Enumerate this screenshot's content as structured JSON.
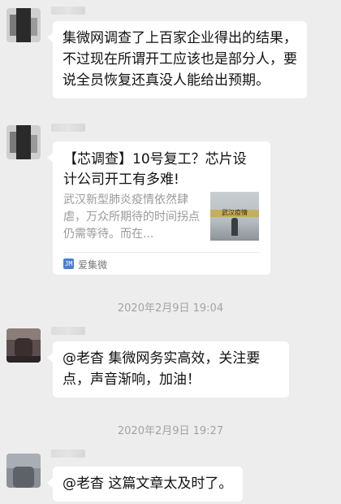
{
  "messages": [
    {
      "type": "text",
      "text": "集微网调查了上百家企业得出的结果，不过现在所谓开工应该也是部分人，要说全员恢复还真没人能给出预期。"
    },
    {
      "type": "article",
      "title": "【芯调查】10号复工？芯片设计公司开工有多难!",
      "summary": "武汉新型肺炎疫情依然肆虐，万众所期待的时间拐点仍需等待。而在...",
      "thumb_caption": "武汉疫情",
      "source_icon": "JM",
      "source": "爱集微"
    },
    {
      "type": "time",
      "text": "2020年2月9日 19:04"
    },
    {
      "type": "text",
      "text": "@老杳 集微网务实高效，关注要点，声音渐响，加油！"
    },
    {
      "type": "time",
      "text": "2020年2月9日 19:27"
    },
    {
      "type": "text",
      "text": "@老杳 这篇文章太及时了。"
    }
  ]
}
